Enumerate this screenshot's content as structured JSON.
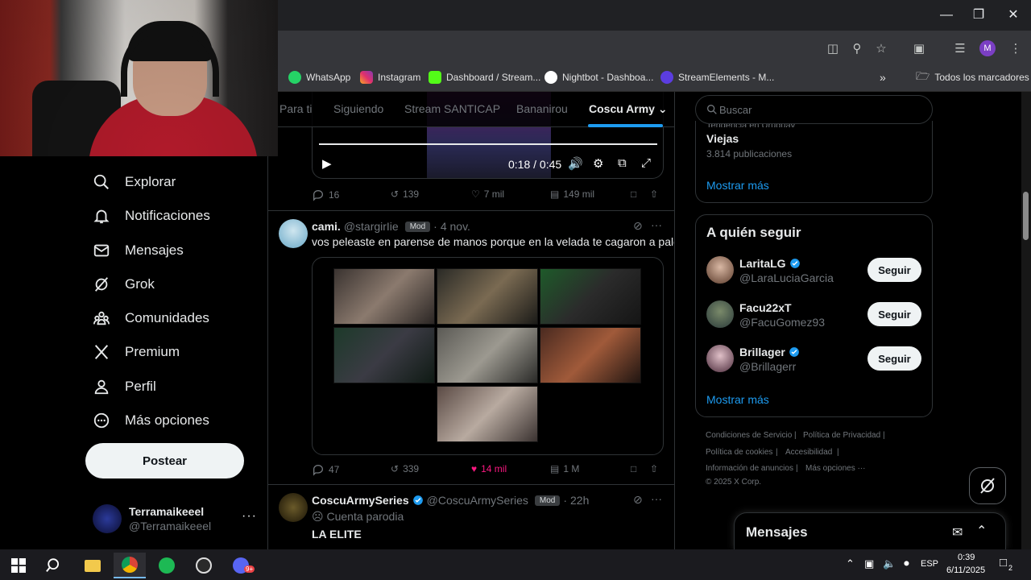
{
  "browser": {
    "profile_initial": "M",
    "bookmarks": [
      {
        "label": "WhatsApp",
        "color": "#25d366"
      },
      {
        "label": "Instagram",
        "color": "#e1306c"
      },
      {
        "label": "Dashboard / Stream...",
        "color": "#53fc18"
      },
      {
        "label": "Nightbot - Dashboa...",
        "color": "#ffffff"
      },
      {
        "label": "StreamElements - M...",
        "color": "#5b3de0"
      }
    ],
    "all_bookmarks_label": "Todos los marcadores"
  },
  "nav": {
    "items": [
      {
        "label": "Explorar",
        "icon": "search-icon"
      },
      {
        "label": "Notificaciones",
        "icon": "bell-icon"
      },
      {
        "label": "Mensajes",
        "icon": "envelope-icon"
      },
      {
        "label": "Grok",
        "icon": "grok-icon"
      },
      {
        "label": "Comunidades",
        "icon": "people-icon"
      },
      {
        "label": "Premium",
        "icon": "x-logo-icon"
      },
      {
        "label": "Perfil",
        "icon": "person-icon"
      },
      {
        "label": "Más opciones",
        "icon": "more-circle-icon"
      }
    ],
    "post_label": "Postear",
    "account": {
      "name": "Terramaikeeel",
      "handle": "@Terramaikeeel"
    }
  },
  "feed": {
    "tabs": [
      "Para ti",
      "Siguiendo",
      "Stream SANTICAP",
      "Bananirou",
      "Coscu Army"
    ],
    "active_tab": "Coscu Army",
    "video": {
      "time": "0:18 / 0:45"
    },
    "tweet1_actions": {
      "replies": "16",
      "reposts": "139",
      "likes": "7 mil",
      "views": "149 mil"
    },
    "tweet2": {
      "name": "cami.",
      "handle": "@stargirIie",
      "badge": "Mod",
      "date": "4 nov.",
      "text": "vos peleaste en parense de manos porque en la velada te cagaron a palos",
      "actions": {
        "replies": "47",
        "reposts": "339",
        "likes": "14 mil",
        "views": "1 M"
      }
    },
    "tweet3": {
      "name": "CoscuArmySeries",
      "handle": "@CoscuArmySeries",
      "badge": "Mod",
      "date": "22h",
      "parody": "Cuenta parodia",
      "text": "LA ELITE"
    }
  },
  "sidebar": {
    "search_placeholder": "Buscar",
    "trend": {
      "context": "Tendencia en Uruguay",
      "name": "Viejas",
      "count": "3.814 publicaciones"
    },
    "show_more": "Mostrar más",
    "who_to_follow_title": "A quién seguir",
    "suggestions": [
      {
        "name": "LaritaLG",
        "handle": "@LaraLuciaGarcia",
        "verified": true,
        "button": "Seguir"
      },
      {
        "name": "Facu22xT",
        "handle": "@FacuGomez93",
        "verified": false,
        "button": "Seguir"
      },
      {
        "name": "Brillager",
        "handle": "@Brillagerr",
        "verified": true,
        "button": "Seguir"
      }
    ],
    "footer": {
      "terms": "Condiciones de Servicio",
      "privacy": "Política de Privacidad",
      "cookies": "Política de cookies",
      "accessibility": "Accesibilidad",
      "ads": "Información de anuncios",
      "more": "Más opciones ···",
      "copyright": "© 2025 X Corp."
    },
    "messages_title": "Mensajes"
  },
  "taskbar": {
    "language": "ESP",
    "time": "0:39",
    "date": "6/11/2025",
    "notifications": "2",
    "discord_badge": "9+"
  },
  "colors": {
    "accent": "#1d9bf0",
    "like": "#f91880",
    "background": "#000000"
  }
}
